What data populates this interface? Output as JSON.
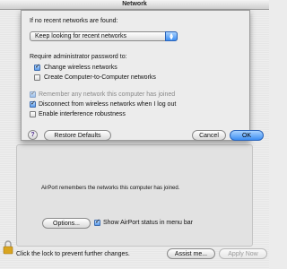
{
  "window": {
    "title": "Network",
    "info_text": "AirPort remembers the networks this computer has joined.",
    "options_button": "Options...",
    "show_status_label": "Show AirPort status in menu bar",
    "lock_text": "Click the lock to prevent further changes.",
    "assist_button": "Assist me...",
    "apply_button": "Apply Now"
  },
  "sheet": {
    "no_networks_label": "If no recent networks are found:",
    "no_networks_select": "Keep looking for recent networks",
    "require_password_label": "Require administrator password to:",
    "options": [
      {
        "label": "Change wireless networks",
        "checked": true,
        "enabled": true
      },
      {
        "label": "Create Computer-to-Computer networks",
        "checked": false,
        "enabled": true
      },
      {
        "label": "Remember any network this computer has joined",
        "checked": true,
        "enabled": false
      },
      {
        "label": "Disconnect from wireless networks when I log out",
        "checked": true,
        "enabled": true
      },
      {
        "label": "Enable interference robustness",
        "checked": false,
        "enabled": true
      }
    ],
    "help_glyph": "?",
    "restore_button": "Restore Defaults",
    "cancel_button": "Cancel",
    "ok_button": "OK"
  },
  "colors": {
    "accent": "#3d8ef2",
    "window_bg": "#ececec"
  },
  "icons": [
    "lock-icon",
    "help-icon",
    "popup-arrows-icon",
    "checkmark-icon"
  ]
}
